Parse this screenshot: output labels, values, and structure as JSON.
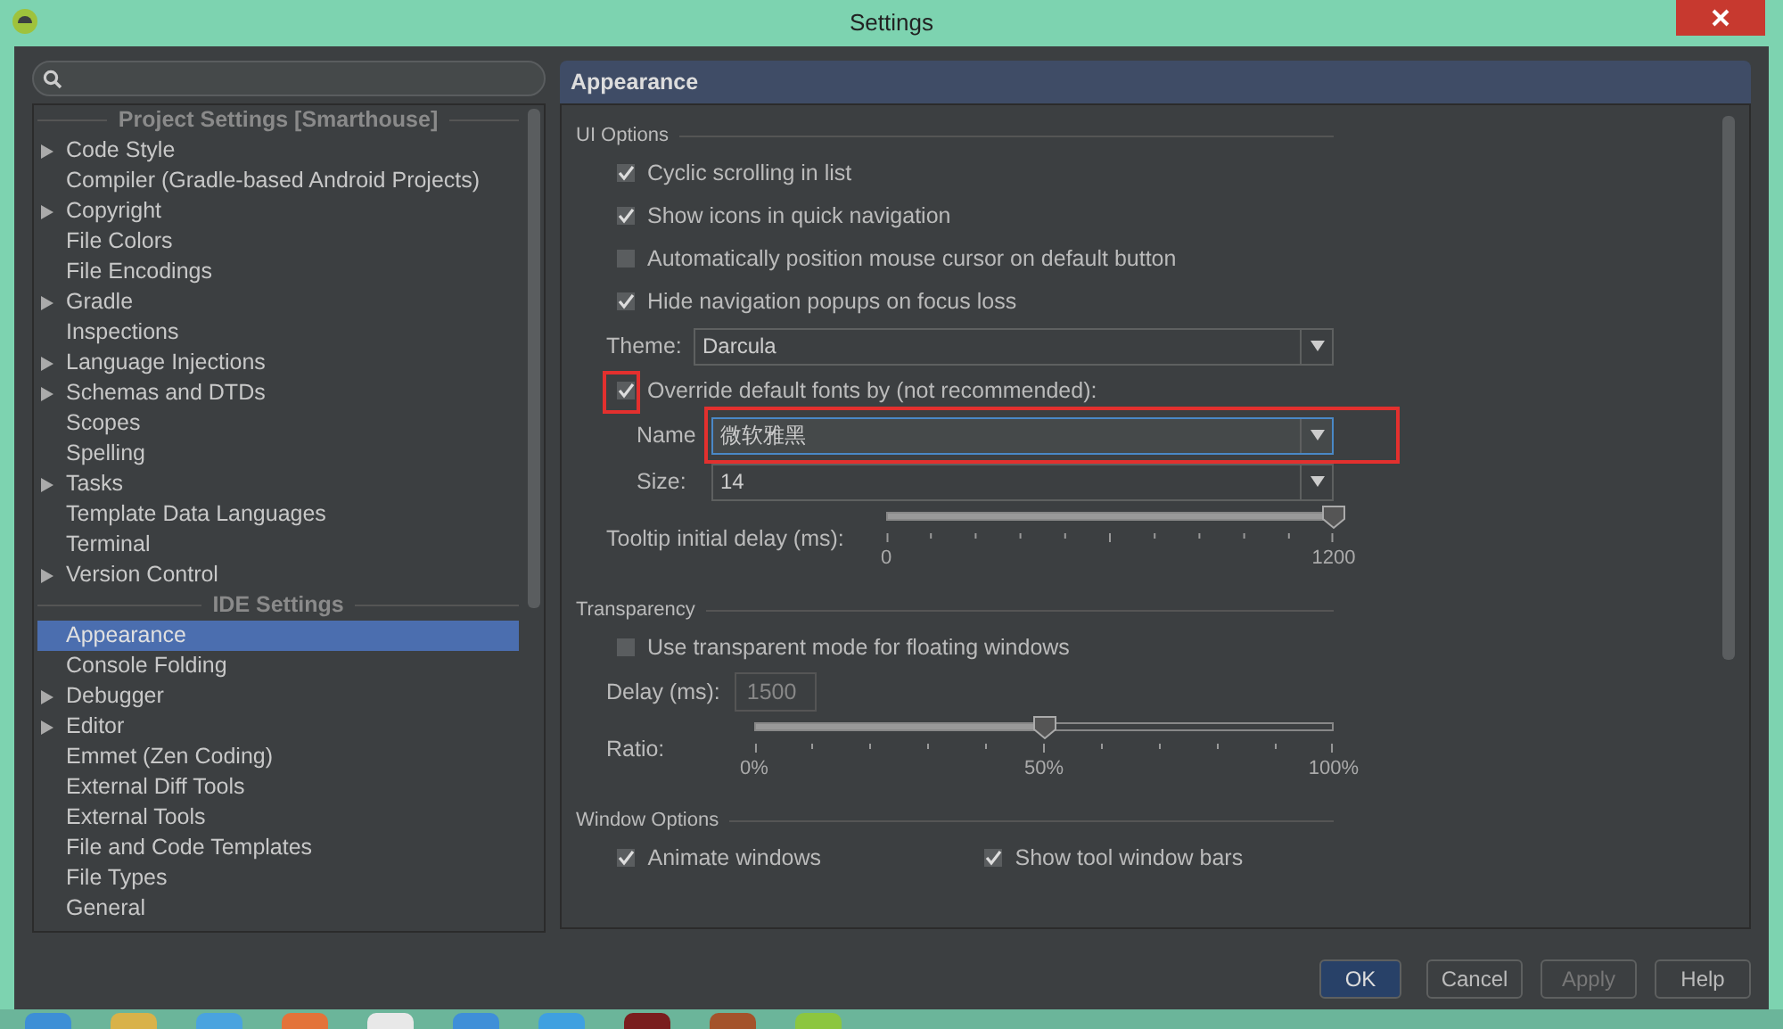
{
  "window": {
    "title": "Settings"
  },
  "sidebar": {
    "sections": [
      {
        "header": "Project Settings [Smarthouse]",
        "items": [
          {
            "label": "Code Style",
            "expandable": true,
            "selected": false
          },
          {
            "label": "Compiler (Gradle-based Android Projects)",
            "expandable": false,
            "selected": false
          },
          {
            "label": "Copyright",
            "expandable": true,
            "selected": false
          },
          {
            "label": "File Colors",
            "expandable": false,
            "selected": false
          },
          {
            "label": "File Encodings",
            "expandable": false,
            "selected": false
          },
          {
            "label": "Gradle",
            "expandable": true,
            "selected": false
          },
          {
            "label": "Inspections",
            "expandable": false,
            "selected": false
          },
          {
            "label": "Language Injections",
            "expandable": true,
            "selected": false
          },
          {
            "label": "Schemas and DTDs",
            "expandable": true,
            "selected": false
          },
          {
            "label": "Scopes",
            "expandable": false,
            "selected": false
          },
          {
            "label": "Spelling",
            "expandable": false,
            "selected": false
          },
          {
            "label": "Tasks",
            "expandable": true,
            "selected": false
          },
          {
            "label": "Template Data Languages",
            "expandable": false,
            "selected": false
          },
          {
            "label": "Terminal",
            "expandable": false,
            "selected": false
          },
          {
            "label": "Version Control",
            "expandable": true,
            "selected": false
          }
        ]
      },
      {
        "header": "IDE Settings",
        "items": [
          {
            "label": "Appearance",
            "expandable": false,
            "selected": true
          },
          {
            "label": "Console Folding",
            "expandable": false,
            "selected": false
          },
          {
            "label": "Debugger",
            "expandable": true,
            "selected": false
          },
          {
            "label": "Editor",
            "expandable": true,
            "selected": false
          },
          {
            "label": "Emmet (Zen Coding)",
            "expandable": false,
            "selected": false
          },
          {
            "label": "External Diff Tools",
            "expandable": false,
            "selected": false
          },
          {
            "label": "External Tools",
            "expandable": false,
            "selected": false
          },
          {
            "label": "File and Code Templates",
            "expandable": false,
            "selected": false
          },
          {
            "label": "File Types",
            "expandable": false,
            "selected": false
          },
          {
            "label": "General",
            "expandable": false,
            "selected": false
          }
        ]
      }
    ]
  },
  "content": {
    "title": "Appearance",
    "groups": [
      {
        "title": "UI Options",
        "rows": [
          {
            "kind": "checkbox",
            "label": "Cyclic scrolling in list",
            "checked": true
          },
          {
            "kind": "checkbox",
            "label": "Show icons in quick navigation",
            "checked": true
          },
          {
            "kind": "checkbox",
            "label": "Automatically position mouse cursor on default button",
            "checked": false
          },
          {
            "kind": "checkbox",
            "label": "Hide navigation popups on focus loss",
            "checked": true
          },
          {
            "kind": "combo",
            "label": "Theme:",
            "value": "Darcula",
            "indent": false,
            "focused": false,
            "annotated": false
          },
          {
            "kind": "checkbox",
            "label": "Override default fonts by (not recommended):",
            "checked": true,
            "annotated": true
          },
          {
            "kind": "combo",
            "label": "Name",
            "value": "微软雅黑",
            "indent": true,
            "focused": true,
            "annotated": true
          },
          {
            "kind": "combo",
            "label": "Size:",
            "value": "14",
            "indent": true,
            "focused": false,
            "annotated": false
          },
          {
            "kind": "slider",
            "label": "Tooltip initial delay (ms):",
            "level": 1.0,
            "tick_labels": [
              "0",
              "1200"
            ]
          }
        ]
      },
      {
        "title": "Transparency",
        "rows": [
          {
            "kind": "checkbox",
            "label": "Use transparent mode for floating windows",
            "checked": false
          },
          {
            "kind": "text",
            "label": "Delay (ms):",
            "value": "1500",
            "disabled": true
          },
          {
            "kind": "slider",
            "label": "Ratio:",
            "level": 0.5,
            "tick_labels": [
              "0%",
              "50%",
              "100%"
            ]
          }
        ]
      },
      {
        "title": "Window Options",
        "rows": [
          {
            "kind": "checkpair",
            "items": [
              {
                "label": "Animate windows",
                "checked": true
              },
              {
                "label": "Show tool window bars",
                "checked": true
              }
            ]
          }
        ]
      }
    ]
  },
  "buttons": [
    {
      "label": "OK",
      "default": true,
      "disabled": false
    },
    {
      "label": "Cancel",
      "default": false,
      "disabled": false
    },
    {
      "label": "Apply",
      "default": false,
      "disabled": true
    },
    {
      "label": "Help",
      "default": false,
      "disabled": false
    }
  ]
}
